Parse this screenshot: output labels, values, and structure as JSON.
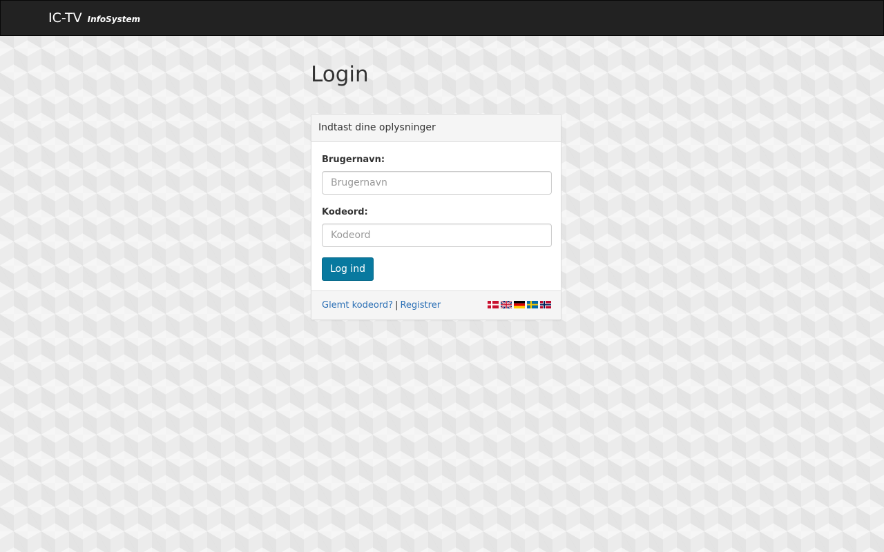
{
  "navbar": {
    "brand": "IC-TV",
    "brand_sub": "InfoSystem",
    "background": "#222222"
  },
  "page": {
    "title": "Login"
  },
  "panel": {
    "heading": "Indtast dine oplysninger",
    "username": {
      "label": "Brugernavn:",
      "placeholder": "Brugernavn",
      "value": ""
    },
    "password": {
      "label": "Kodeord:",
      "placeholder": "Kodeord",
      "value": ""
    },
    "submit_label": "Log ind",
    "submit_color": "#08799f"
  },
  "footer": {
    "forgot_label": "Glemt kodeord?",
    "separator": "|",
    "register_label": "Registrer",
    "link_color": "#2a6fb5",
    "languages": [
      {
        "icon": "flag-denmark-icon"
      },
      {
        "icon": "flag-uk-icon"
      },
      {
        "icon": "flag-germany-icon"
      },
      {
        "icon": "flag-sweden-icon"
      },
      {
        "icon": "flag-norway-icon"
      }
    ]
  }
}
